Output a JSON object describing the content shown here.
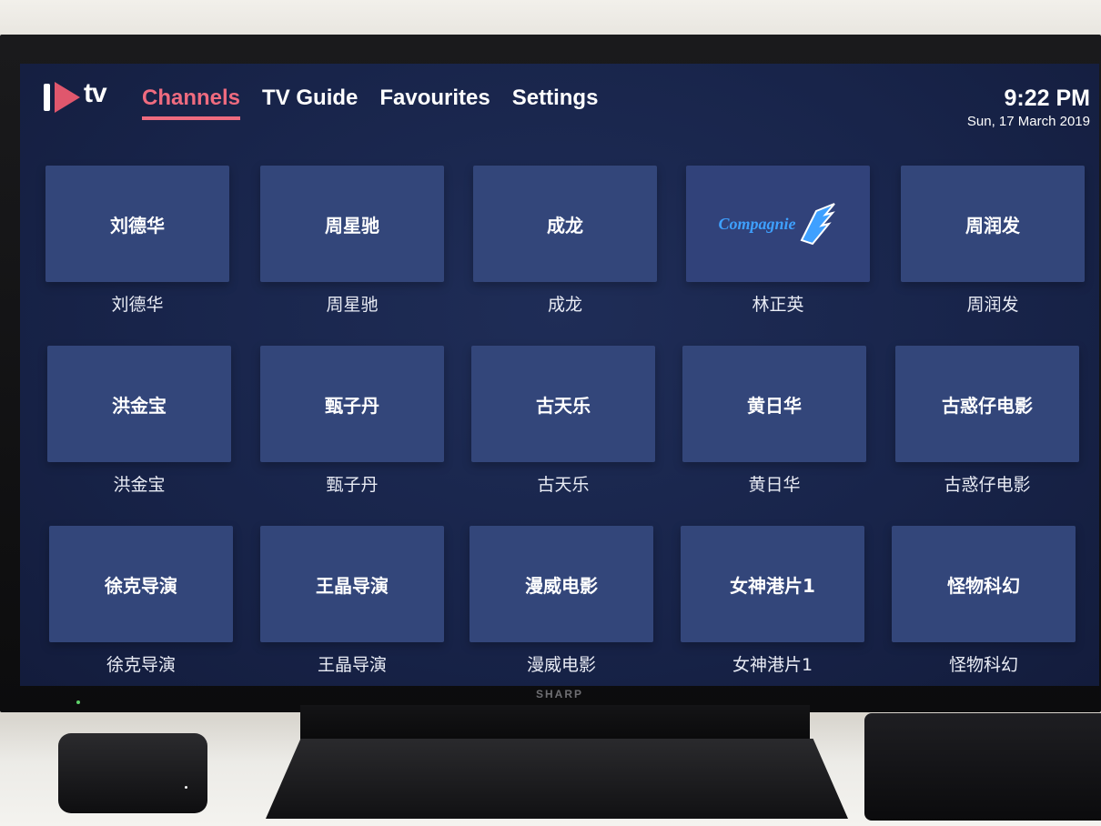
{
  "app": {
    "logo_text": "tv",
    "accent": "#ef6b7f"
  },
  "nav": [
    {
      "label": "Channels",
      "active": true
    },
    {
      "label": "TV Guide",
      "active": false
    },
    {
      "label": "Favourites",
      "active": false
    },
    {
      "label": "Settings",
      "active": false
    }
  ],
  "clock": {
    "time": "9:22 PM",
    "date": "Sun, 17 March 2019"
  },
  "tv_brand": "SHARP",
  "channels": [
    {
      "tile": "刘德华",
      "caption": "刘德华"
    },
    {
      "tile": "周星驰",
      "caption": "周星驰"
    },
    {
      "tile": "成龙",
      "caption": "成龙"
    },
    {
      "tile": "Compagnie",
      "caption": "林正英",
      "is_logo": true
    },
    {
      "tile": "周润发",
      "caption": "周润发"
    },
    {
      "tile": "洪金宝",
      "caption": "洪金宝"
    },
    {
      "tile": "甄子丹",
      "caption": "甄子丹"
    },
    {
      "tile": "古天乐",
      "caption": "古天乐"
    },
    {
      "tile": "黄日华",
      "caption": "黄日华"
    },
    {
      "tile": "古惑仔电影",
      "caption": "古惑仔电影"
    },
    {
      "tile": "徐克导演",
      "caption": "徐克导演"
    },
    {
      "tile": "王晶导演",
      "caption": "王晶导演"
    },
    {
      "tile": "漫威电影",
      "caption": "漫威电影"
    },
    {
      "tile": "女神港片1",
      "caption": "女神港片1"
    },
    {
      "tile": "怪物科幻",
      "caption": "怪物科幻"
    }
  ]
}
